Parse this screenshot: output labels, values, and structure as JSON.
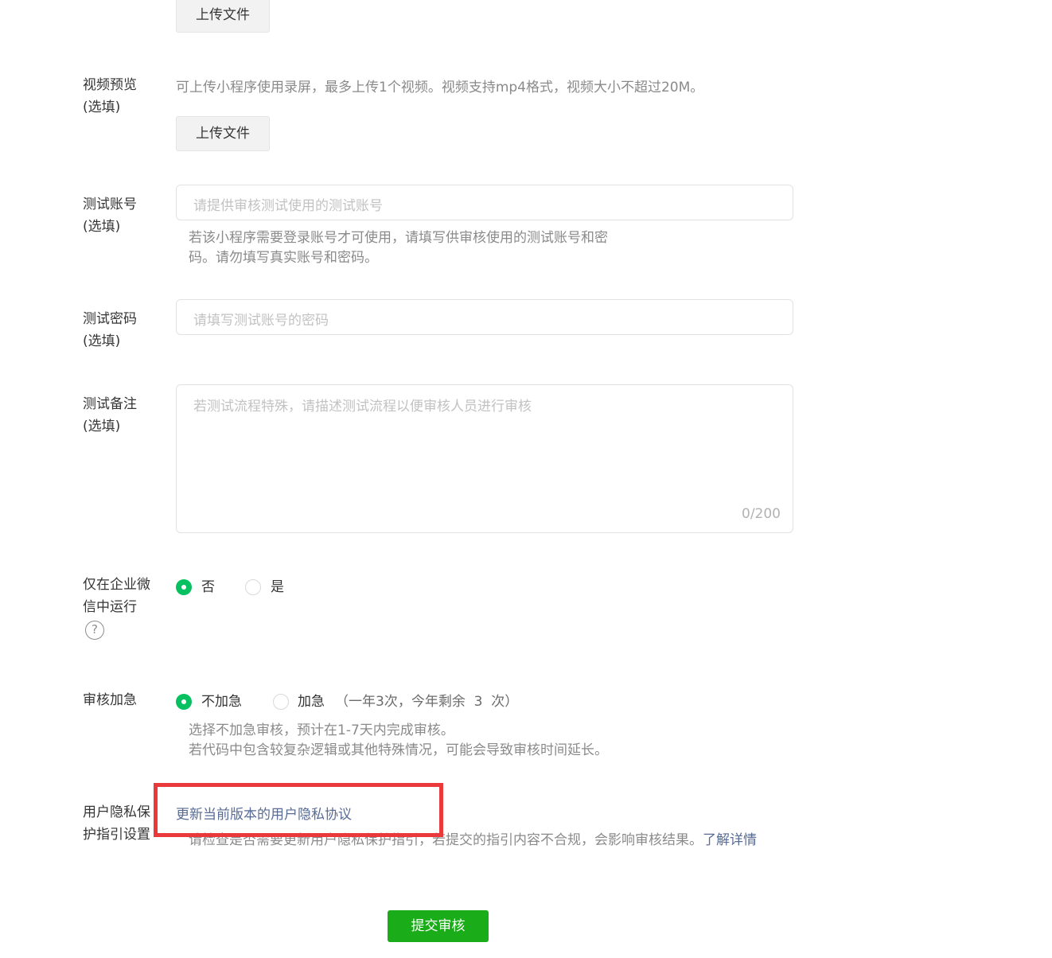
{
  "upload_top": {
    "button_label": "上传文件"
  },
  "video_preview": {
    "label_line1": "视频预览",
    "label_line2": "(选填)",
    "hint": "可上传小程序使用录屏，最多上传1个视频。视频支持mp4格式，视频大小不超过20M。",
    "button_label": "上传文件"
  },
  "test_account": {
    "label_line1": "测试账号",
    "label_line2": "(选填)",
    "placeholder": "请提供审核测试使用的测试账号",
    "hint_line1": "若该小程序需要登录账号才可使用，请填写供审核使用的测试账号和密",
    "hint_line2": "码。请勿填写真实账号和密码。"
  },
  "test_password": {
    "label_line1": "测试密码",
    "label_line2": "(选填)",
    "placeholder": "请填写测试账号的密码"
  },
  "test_notes": {
    "label_line1": "测试备注",
    "label_line2": "(选填)",
    "placeholder": "若测试流程特殊，请描述测试流程以便审核人员进行审核",
    "counter": "0/200"
  },
  "wework_only": {
    "label_line1": "仅在企业微",
    "label_line2": "信中运行",
    "help_symbol": "?",
    "options": [
      "否",
      "是"
    ],
    "selected": "否"
  },
  "expedite": {
    "label": "审核加急",
    "options": [
      "不加急",
      "加急"
    ],
    "selected": "不加急",
    "quota_text": "（一年3次，今年剩余  3  次）",
    "hint_line1": "选择不加急审核，预计在1-7天内完成审核。",
    "hint_line2": "若代码中包含较复杂逻辑或其他特殊情况，可能会导致审核时间延长。"
  },
  "privacy": {
    "label_line1": "用户隐私保",
    "label_line2": "护指引设置",
    "update_link": "更新当前版本的用户隐私协议",
    "hint": "请检查是否需要更新用户隐私保护指引，若提交的指引内容不合规，会影响审核结果。",
    "learn_more": "了解详情"
  },
  "submit": {
    "label": "提交审核"
  },
  "colors": {
    "accent_green": "#07c160",
    "submit_green": "#1aad19",
    "link_blue": "#576b95",
    "highlight_red": "#e9393a"
  }
}
